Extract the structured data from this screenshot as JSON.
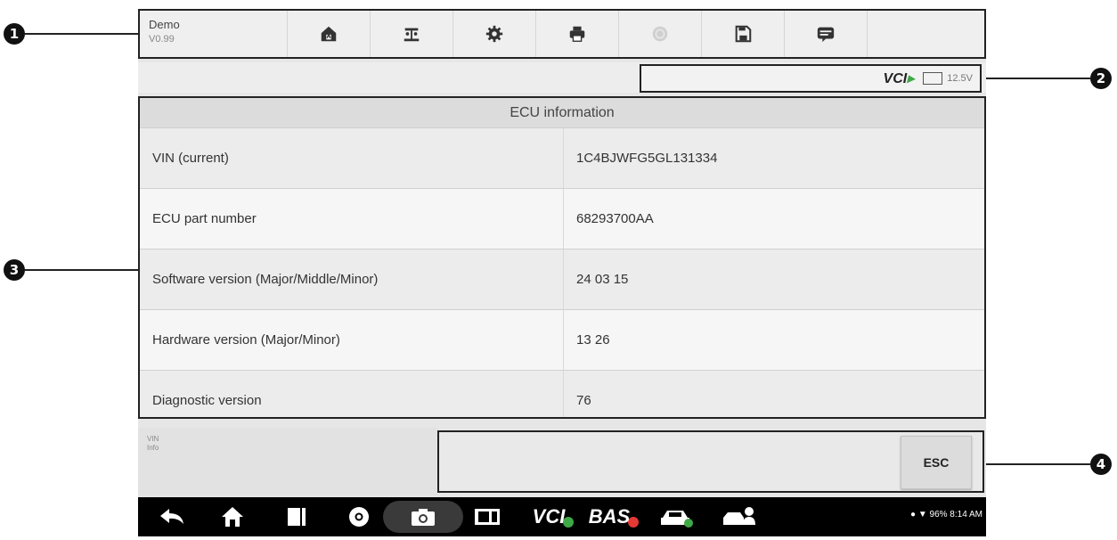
{
  "toolbar": {
    "title": "Demo",
    "version": "V0.99",
    "buttons": [
      "home-icon",
      "vehicle-lift-icon",
      "settings-icon",
      "print-icon",
      "help-icon",
      "save-icon",
      "message-icon"
    ]
  },
  "status": {
    "vci_label": "VCI",
    "battery_voltage": "12.5V"
  },
  "ecu": {
    "title": "ECU information",
    "rows": [
      {
        "label": "VIN (current)",
        "value": "1C4BJWFG5GL131334"
      },
      {
        "label": "ECU part number",
        "value": "68293700AA"
      },
      {
        "label": "Software version (Major/Middle/Minor)",
        "value": "24 03 15"
      },
      {
        "label": "Hardware version (Major/Minor)",
        "value": "13 26"
      },
      {
        "label": "Diagnostic version",
        "value": "76"
      }
    ]
  },
  "info": {
    "line1": "VIN",
    "line2": "Info"
  },
  "actions": {
    "esc_label": "ESC"
  },
  "navbar": {
    "vci": "VCI",
    "bas": "BAS",
    "status_text": "96% 8:14 AM"
  },
  "callouts": [
    "1",
    "2",
    "3",
    "4"
  ],
  "colors": {
    "accent_green": "#3fa847",
    "alert_red": "#e53935",
    "nav_bg": "#000000"
  }
}
